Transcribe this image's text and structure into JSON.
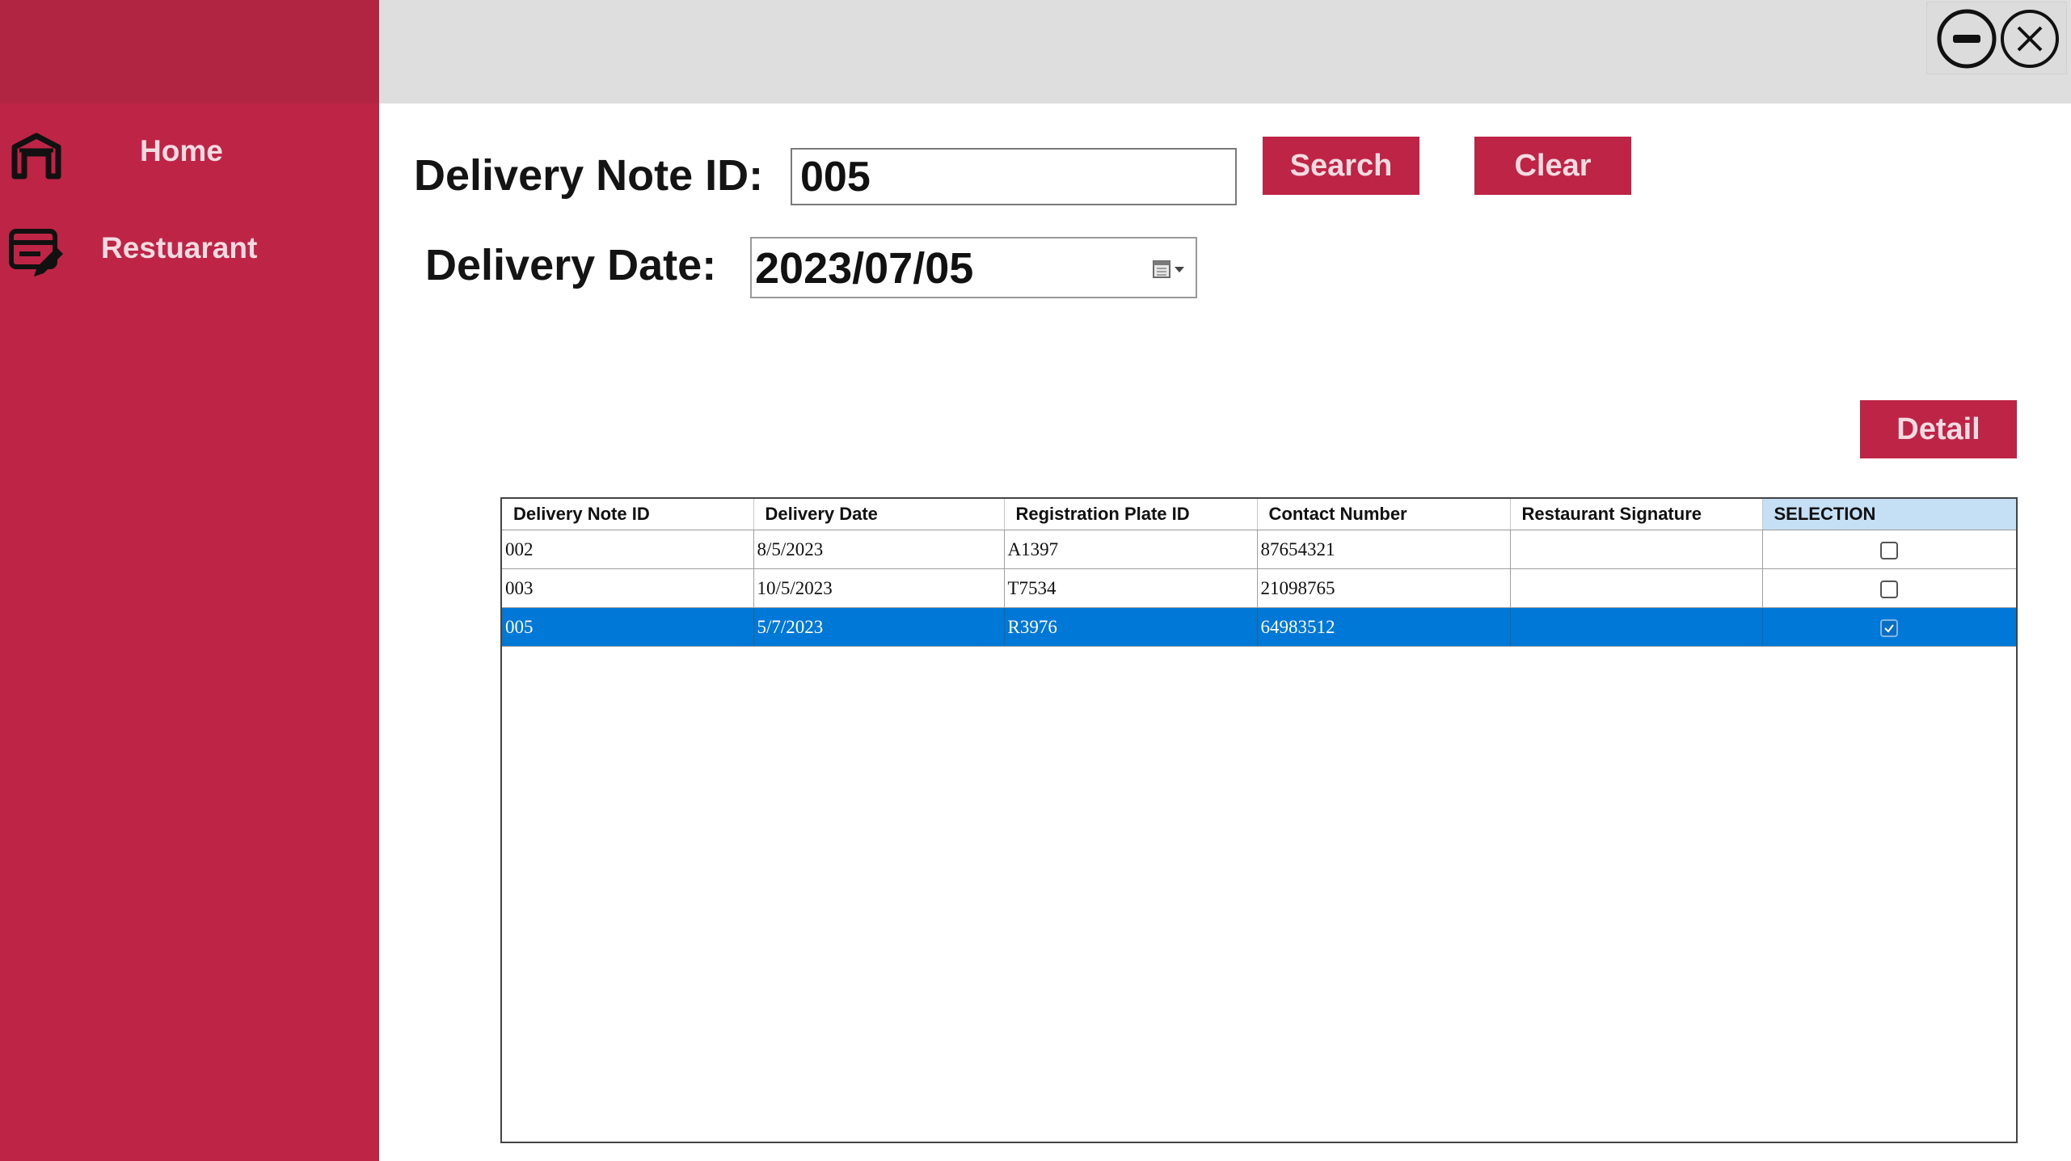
{
  "sidebar": {
    "items": [
      {
        "label": "Home",
        "icon": "home-icon"
      },
      {
        "label": "Restuarant",
        "icon": "restaurant-edit-icon"
      }
    ]
  },
  "window_controls": {
    "minimize_icon": "minimize-icon",
    "close_icon": "close-icon"
  },
  "form": {
    "delivery_note_id_label": "Delivery Note ID:",
    "delivery_note_id_value": "005",
    "delivery_date_label": "Delivery Date:",
    "delivery_date_value": "2023/07/05",
    "search_label": "Search",
    "clear_label": "Clear",
    "detail_label": "Detail"
  },
  "table": {
    "columns": [
      "Delivery Note ID",
      "Delivery Date",
      "Registration Plate ID",
      "Contact Number",
      "Restaurant Signature",
      "SELECTION"
    ],
    "rows": [
      {
        "id": "002",
        "date": "8/5/2023",
        "plate": "A1397",
        "contact": "87654321",
        "signature": "",
        "selected": false
      },
      {
        "id": "003",
        "date": "10/5/2023",
        "plate": "T7534",
        "contact": "21098765",
        "signature": "",
        "selected": false
      },
      {
        "id": "005",
        "date": "5/7/2023",
        "plate": "R3976",
        "contact": "64983512",
        "signature": "",
        "selected": true
      }
    ]
  },
  "colors": {
    "accent": "#bd2446",
    "topbar": "#dedede",
    "row_selected": "#0078d7"
  }
}
